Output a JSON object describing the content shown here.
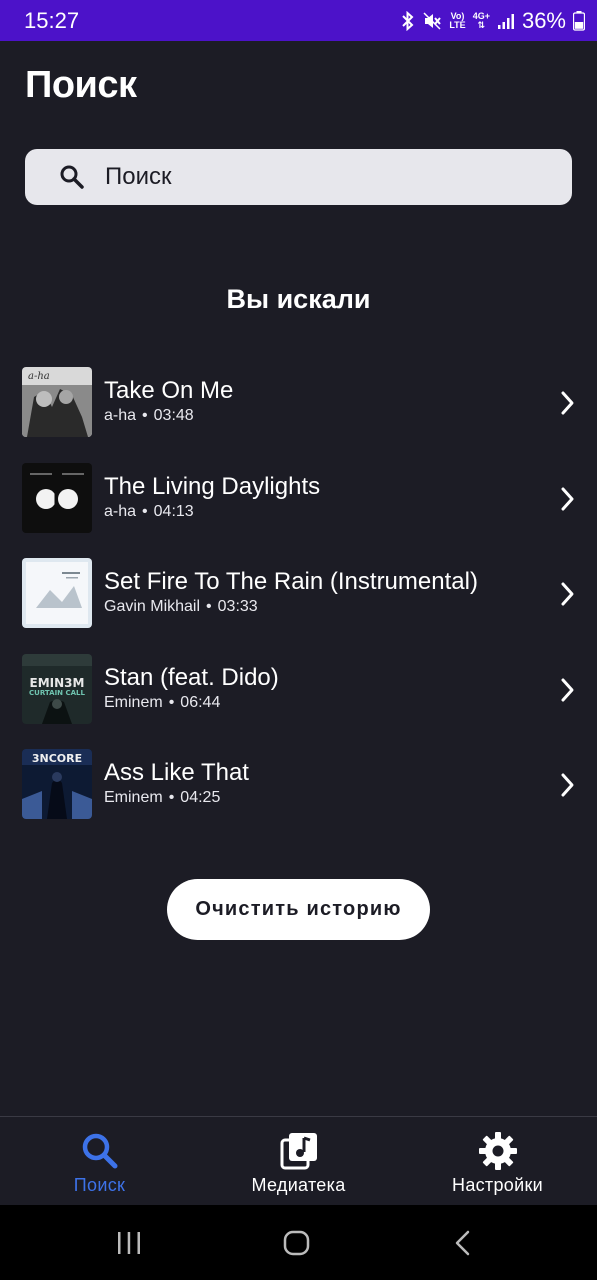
{
  "status_bar": {
    "time": "15:27",
    "net_top": "Vo)",
    "net_bottom": "LTE",
    "net_4g": "4G+",
    "battery": "36%"
  },
  "header": {
    "title": "Поиск"
  },
  "search": {
    "placeholder": "Поиск"
  },
  "history": {
    "heading": "Вы искали",
    "items": [
      {
        "title": "Take On Me",
        "artist": "a-ha",
        "duration": "03:48"
      },
      {
        "title": "The Living Daylights",
        "artist": "a-ha",
        "duration": "04:13"
      },
      {
        "title": "Set Fire To The Rain (Instrumental)",
        "artist": "Gavin Mikhail",
        "duration": "03:33"
      },
      {
        "title": "Stan (feat. Dido)",
        "artist": "Eminem",
        "duration": "06:44"
      },
      {
        "title": "Ass Like That",
        "artist": "Eminem",
        "duration": "04:25"
      }
    ],
    "clear_label": "Очистить историю"
  },
  "cover_text": {
    "aha": "a-ha",
    "eminem": "EMIN3M",
    "curtain": "CURTAIN CALL",
    "encore": "3NCORE"
  },
  "separator": "•",
  "bottom_nav": {
    "search_label": "Поиск",
    "library_label": "Медиатека",
    "settings_label": "Настройки"
  },
  "colors": {
    "background": "#1c1c25",
    "status_bar": "#4c12c9",
    "accent_active": "#3d72e8",
    "search_field": "#e7e7ec"
  }
}
